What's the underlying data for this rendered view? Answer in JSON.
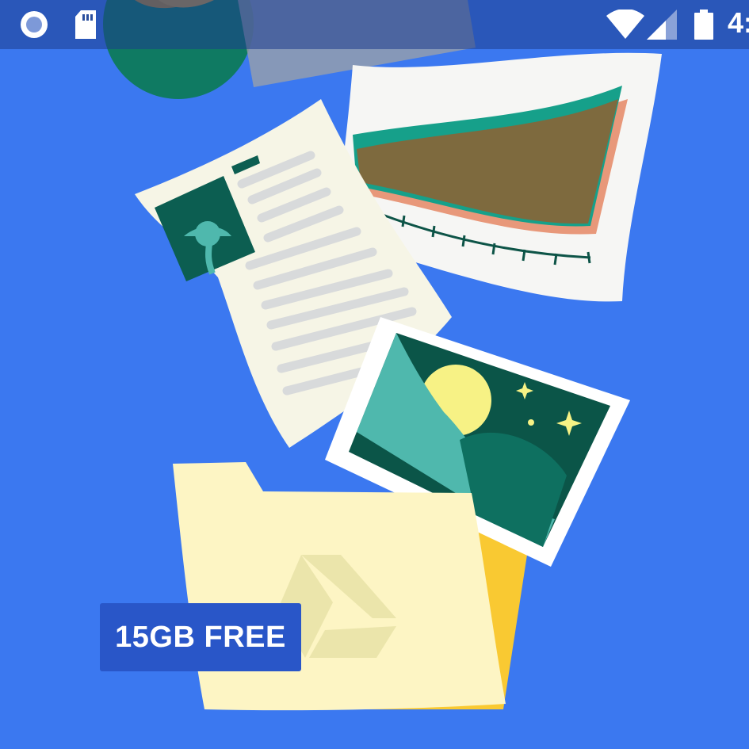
{
  "status_bar": {
    "time": "4:",
    "icons": [
      "record-icon",
      "sd-card-icon",
      "wifi-icon",
      "signal-icon",
      "battery-icon"
    ]
  },
  "promo": {
    "badge_label": "15GB FREE"
  },
  "colors": {
    "background": "#3b78f0",
    "status_bar": "#2a4f9e",
    "badge": "#2956c8",
    "folder": "#fdf5c4",
    "folder_back": "#f9c932",
    "paper": "#f6f5e6",
    "teal_dark": "#075e4f",
    "teal_light": "#4fb8ad",
    "sun": "#f7f285"
  }
}
